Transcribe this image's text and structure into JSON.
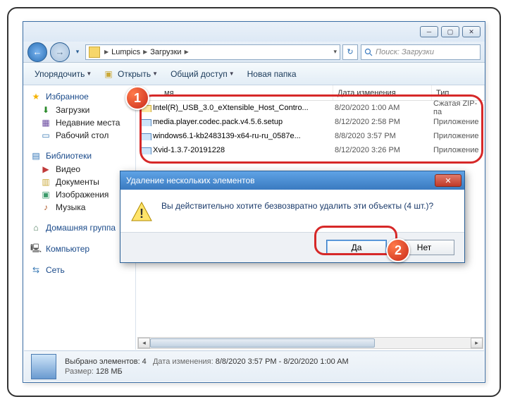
{
  "breadcrumb": {
    "root_icon": "folder-icon",
    "levels": [
      "Lumpics",
      "Загрузки"
    ]
  },
  "search": {
    "placeholder": "Поиск: Загрузки"
  },
  "toolbar": {
    "organize": "Упорядочить",
    "open": "Открыть",
    "share": "Общий доступ",
    "new_folder": "Новая папка"
  },
  "sidebar": {
    "favorites": {
      "label": "Избранное",
      "items": [
        "Загрузки",
        "Недавние места",
        "Рабочий стол"
      ]
    },
    "libraries": {
      "label": "Библиотеки",
      "items": [
        "Видео",
        "Документы",
        "Изображения",
        "Музыка"
      ]
    },
    "homegroup": "Домашняя группа",
    "computer": "Компьютер",
    "network": "Сеть"
  },
  "columns": {
    "name": "мя",
    "date": "Дата изменения",
    "type": "Тип"
  },
  "files": [
    {
      "name": "Intel(R)_USB_3.0_eXtensible_Host_Contro...",
      "date": "8/20/2020 1:00 AM",
      "type": "Сжатая ZIP-па",
      "kind": "zip"
    },
    {
      "name": "media.player.codec.pack.v4.5.6.setup",
      "date": "8/12/2020 2:58 PM",
      "type": "Приложение",
      "kind": "app"
    },
    {
      "name": "windows6.1-kb2483139-x64-ru-ru_0587e...",
      "date": "8/8/2020 3:57 PM",
      "type": "Приложение",
      "kind": "app"
    },
    {
      "name": "Xvid-1.3.7-20191228",
      "date": "8/12/2020 3:26 PM",
      "type": "Приложение",
      "kind": "app"
    }
  ],
  "dialog": {
    "title": "Удаление нескольких элементов",
    "message": "Вы действительно хотите безвозвратно удалить эти объекты (4 шт.)?",
    "yes": "Да",
    "no": "Нет"
  },
  "status": {
    "selected_label": "Выбрано элементов: 4",
    "date_label": "Дата изменения:",
    "date_value": "8/8/2020 3:57 PM - 8/20/2020 1:00 AM",
    "size_label": "Размер:",
    "size_value": "128 МБ"
  },
  "callouts": {
    "one": "1",
    "two": "2"
  }
}
